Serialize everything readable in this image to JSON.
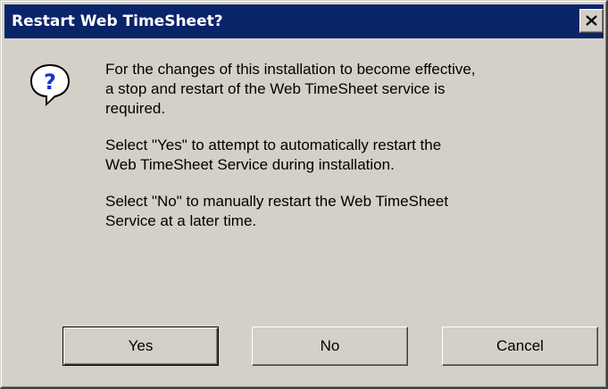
{
  "dialog": {
    "title": "Restart Web TimeSheet?",
    "close_glyph": "X",
    "icon": "question-icon",
    "icon_glyph": "?",
    "message": {
      "paragraph1": "For the changes of this installation to become effective,\na stop and restart of the Web TimeSheet service is\nrequired.",
      "paragraph2": "Select \"Yes\" to  attempt to automatically restart the\nWeb TimeSheet Service during installation.",
      "paragraph3": "Select \"No\" to manually restart the Web TimeSheet\nService at a later time."
    },
    "buttons": {
      "yes": "Yes",
      "no": "No",
      "cancel": "Cancel"
    }
  },
  "colors": {
    "titlebar": "#0a246a",
    "face": "#d4d0c8",
    "icon_mark": "#1a33cc"
  }
}
